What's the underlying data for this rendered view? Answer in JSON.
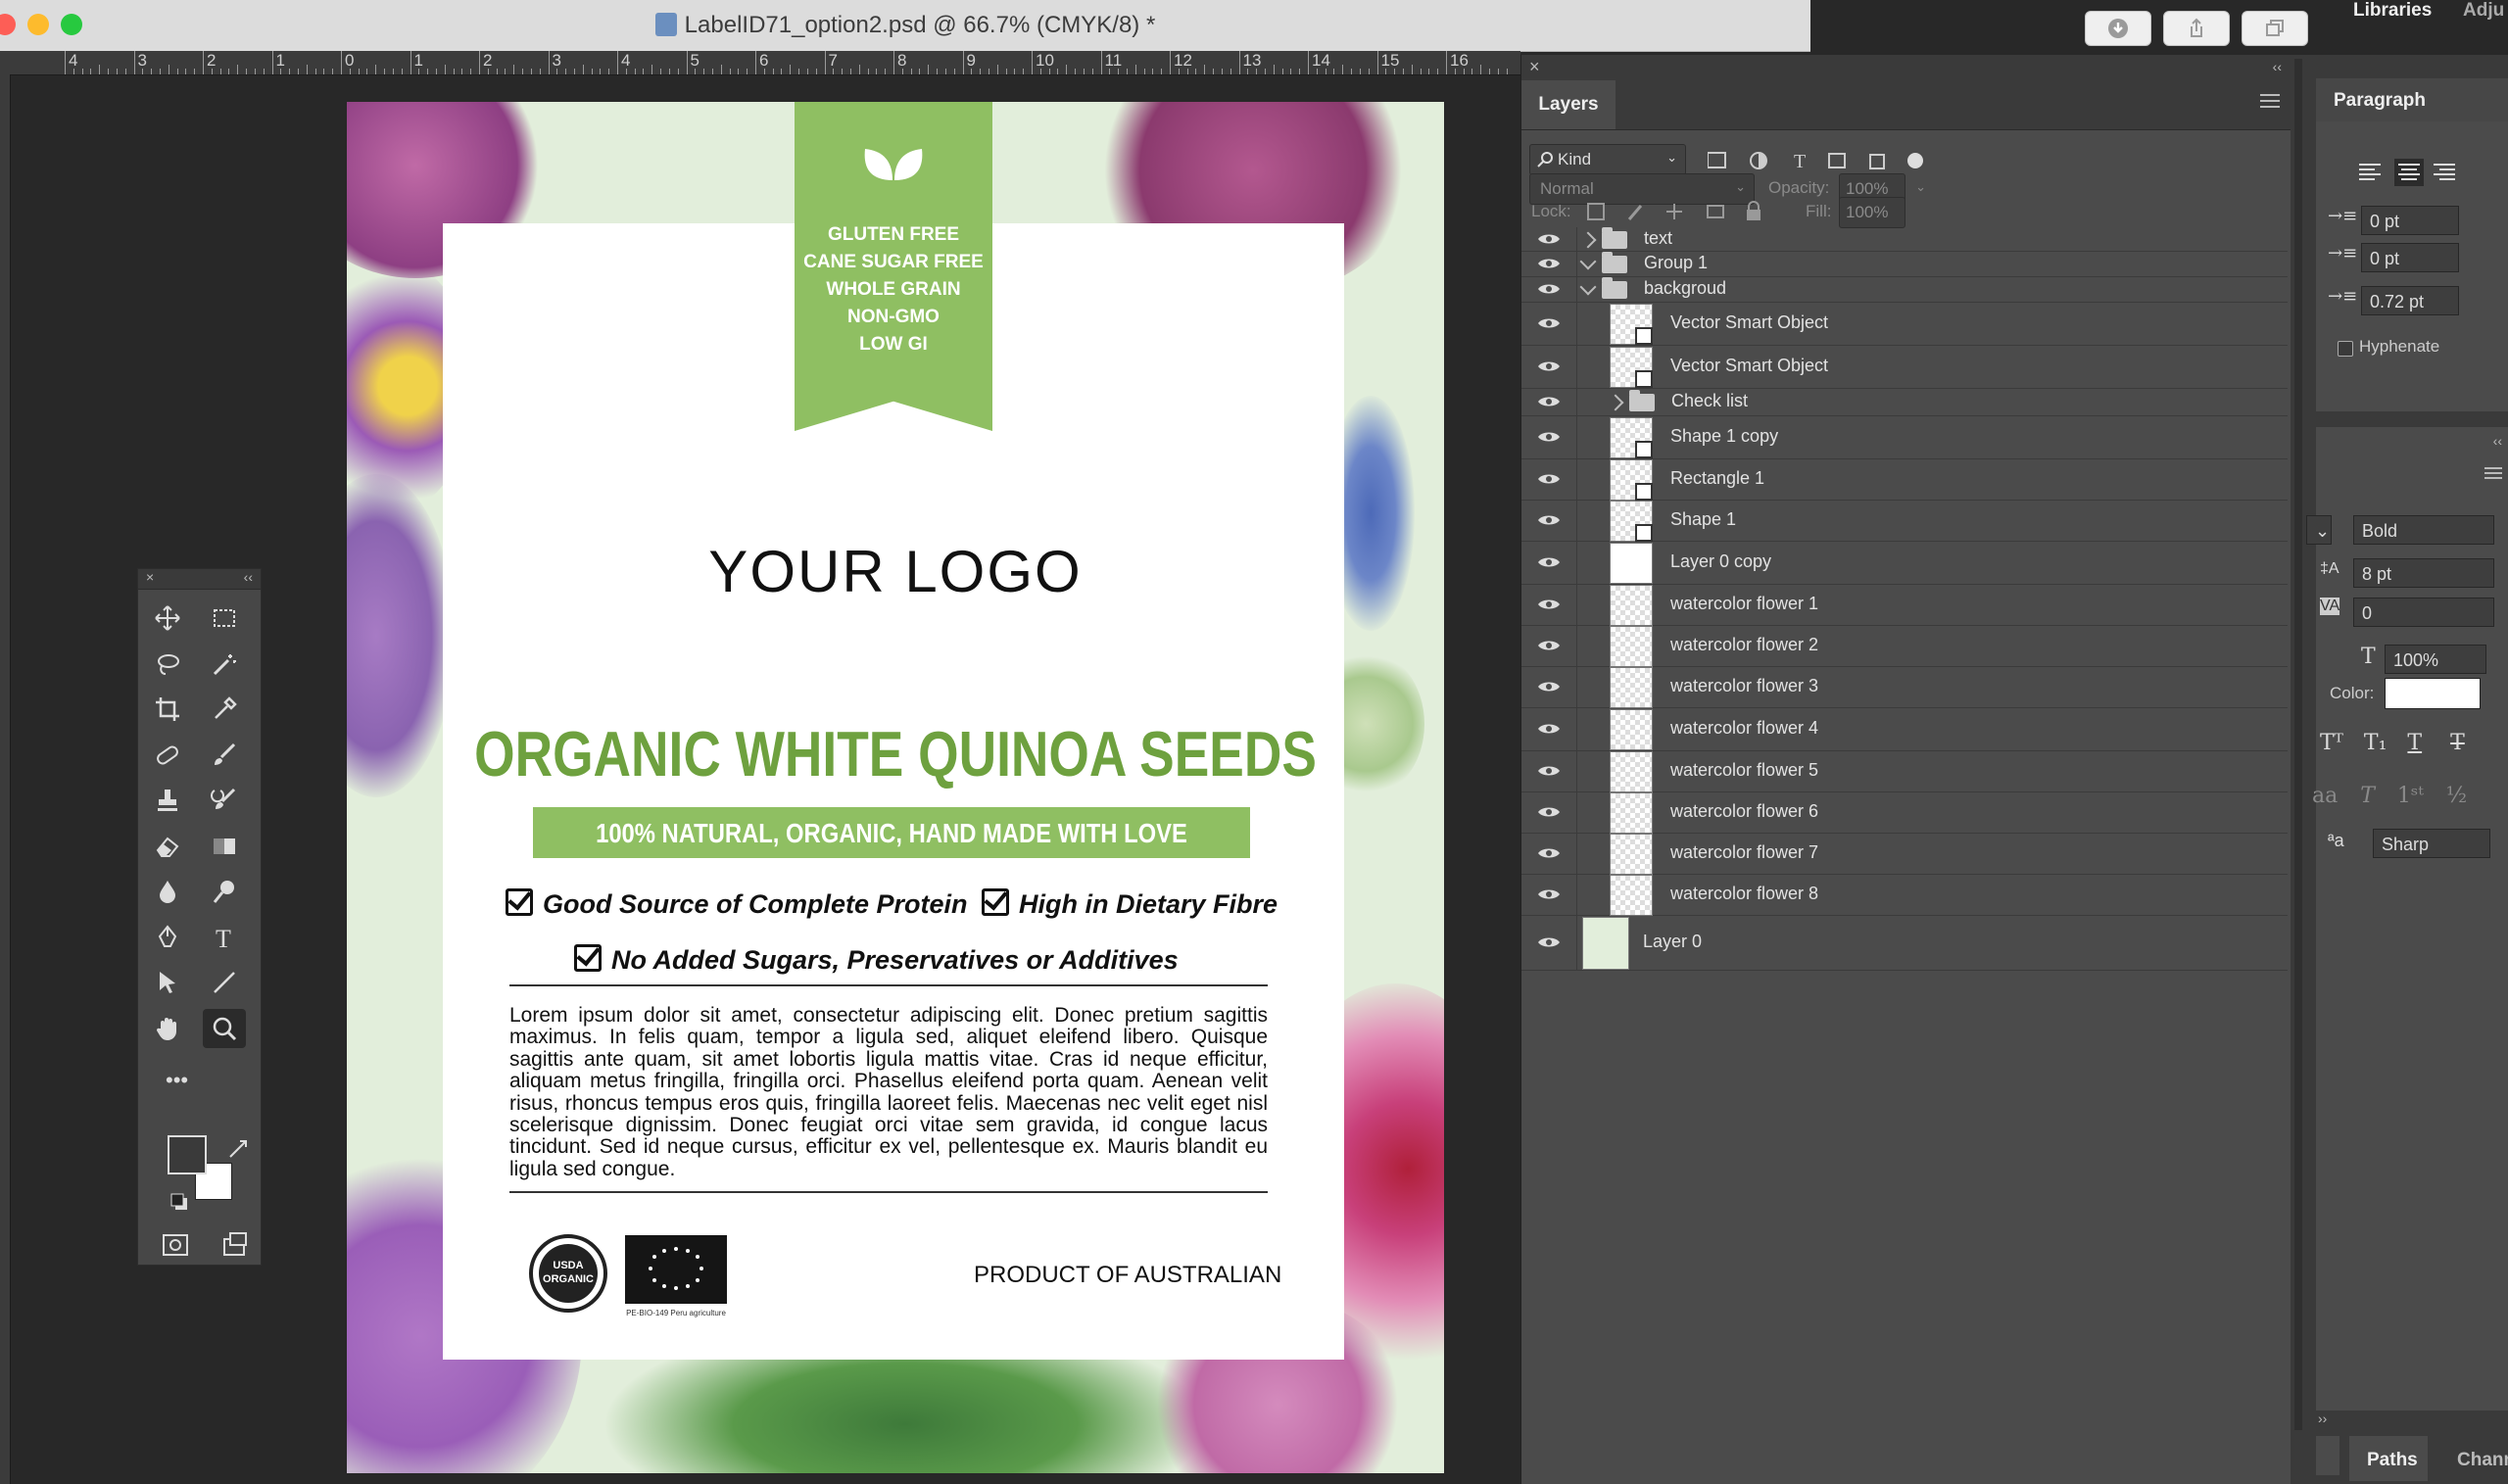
{
  "window": {
    "title": "LabelID71_option2.psd @ 66.7% (CMYK/8) *",
    "traffic_colors": [
      "#fd5e56",
      "#fdbb2d",
      "#27c93f"
    ]
  },
  "ruler": {
    "labels": [
      "4",
      "3",
      "2",
      "1",
      "0",
      "1",
      "2",
      "3",
      "4",
      "5",
      "6",
      "7",
      "8",
      "9",
      "10",
      "11",
      "12",
      "13",
      "14",
      "15",
      "16"
    ]
  },
  "label": {
    "claims": [
      "GLUTEN FREE",
      "CANE SUGAR FREE",
      "WHOLE GRAIN",
      "NON-GMO",
      "LOW GI"
    ],
    "logo": "YOUR LOGO",
    "product_title": "ORGANIC WHITE QUINOA SEEDS",
    "tagline": "100% NATURAL, ORGANIC, HAND MADE WITH LOVE",
    "benefits": [
      "Good Source of Complete Protein",
      "High in Dietary Fibre",
      "No Added Sugars, Preservatives or Additives"
    ],
    "body": "Lorem ipsum dolor sit amet, consectetur adipiscing elit. Donec pretium sagittis maximus. In felis quam, tempor a ligula sed, aliquet eleifend libero. Quisque sagittis ante quam, sit amet lobortis ligula mattis vitae. Cras id neque efficitur, aliquam metus fringilla, fringilla orci. Phasellus eleifend porta quam. Aenean velit risus, rhoncus tempus eros quis, fringilla laoreet felis. Maecenas nec velit eget nisl scelerisque dignissim. Donec feugiat orci vitae sem gravida, id congue lacus tincidunt. Sed id neque cursus, efficitur ex vel, pellentesque ex. Mauris blandit eu ligula sed congue.",
    "usda_text": "USDA ORGANIC",
    "eu_subtext": "PE-BIO-149 Peru agriculture",
    "origin": "PRODUCT OF AUSTRALIAN",
    "colors": {
      "accent_green": "#8fbf62",
      "title_green": "#6ea13f",
      "background": "#e2eedb"
    }
  },
  "layers_panel": {
    "tab": "Layers",
    "filter": "Kind",
    "blend_mode": "Normal",
    "opacity_label": "Opacity:",
    "opacity_value": "100%",
    "lock_label": "Lock:",
    "fill_label": "Fill:",
    "fill_value": "100%",
    "layers": [
      {
        "name": "text",
        "kind": "group",
        "expanded": false,
        "indent": 0
      },
      {
        "name": "Group 1",
        "kind": "group",
        "expanded": true,
        "indent": 0
      },
      {
        "name": "backgroud",
        "kind": "group",
        "expanded": true,
        "indent": 0
      },
      {
        "name": "Vector Smart Object",
        "kind": "smart",
        "indent": 1
      },
      {
        "name": "Vector Smart Object",
        "kind": "smart",
        "indent": 1
      },
      {
        "name": "Check list",
        "kind": "group",
        "expanded": false,
        "indent": 1
      },
      {
        "name": "Shape 1 copy",
        "kind": "shape",
        "indent": 1
      },
      {
        "name": "Rectangle 1",
        "kind": "shape",
        "indent": 1
      },
      {
        "name": "Shape 1",
        "kind": "shape",
        "indent": 1
      },
      {
        "name": "Layer 0 copy",
        "kind": "white",
        "indent": 1
      },
      {
        "name": "watercolor flower 1",
        "kind": "transparent",
        "indent": 1
      },
      {
        "name": "watercolor flower 2",
        "kind": "transparent",
        "indent": 1
      },
      {
        "name": "watercolor flower 3",
        "kind": "transparent",
        "indent": 1
      },
      {
        "name": "watercolor flower 4",
        "kind": "transparent",
        "indent": 1
      },
      {
        "name": "watercolor flower 5",
        "kind": "transparent",
        "indent": 1
      },
      {
        "name": "watercolor flower 6",
        "kind": "transparent",
        "indent": 1
      },
      {
        "name": "watercolor flower 7",
        "kind": "transparent",
        "indent": 1
      },
      {
        "name": "watercolor flower 8",
        "kind": "transparent",
        "indent": 1
      },
      {
        "name": "Layer 0",
        "kind": "fill",
        "indent": 0
      }
    ]
  },
  "right_panels": {
    "libraries_tab": "Libraries",
    "adjust_tab": "Adju",
    "paragraph_tab": "Paragraph",
    "indent_left": "0 pt",
    "indent_right": "0 pt",
    "space_after": "0.72 pt",
    "hyphenate_label": "Hyphenate",
    "font_style": "Bold",
    "leading": "8 pt",
    "tracking": "0",
    "vertical_scale": "100%",
    "color_label": "Color:",
    "antialias": "Sharp",
    "paths_tab": "Paths",
    "channels_tab": "Chann"
  }
}
